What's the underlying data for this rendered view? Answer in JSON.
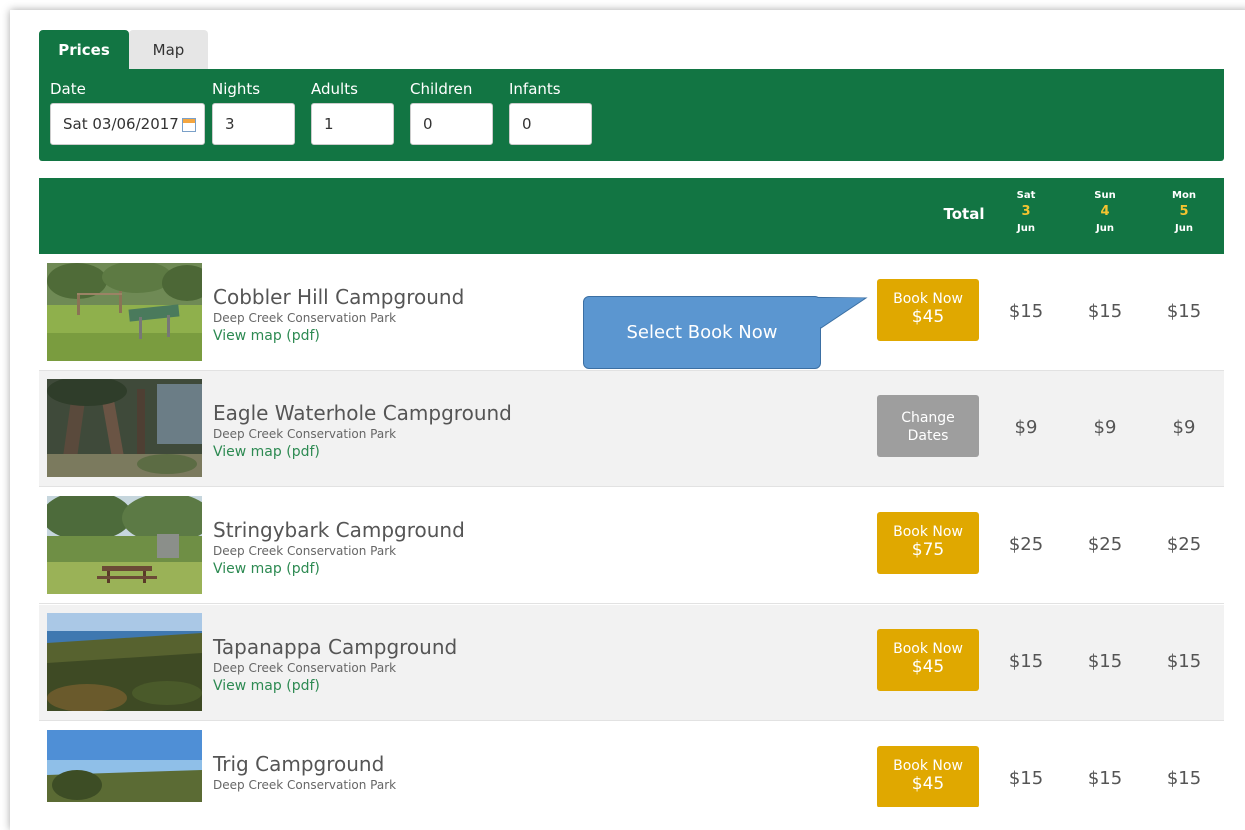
{
  "tabs": [
    {
      "label": "Prices",
      "active": true
    },
    {
      "label": "Map",
      "active": false
    }
  ],
  "filters": {
    "date": {
      "label": "Date",
      "value": "Sat 03/06/2017"
    },
    "nights": {
      "label": "Nights",
      "value": "3"
    },
    "adults": {
      "label": "Adults",
      "value": "1"
    },
    "children": {
      "label": "Children",
      "value": "0"
    },
    "infants": {
      "label": "Infants",
      "value": "0"
    }
  },
  "table_header": {
    "total_label": "Total",
    "days": [
      {
        "dow": "Sat",
        "day": "3",
        "month": "Jun"
      },
      {
        "dow": "Sun",
        "day": "4",
        "month": "Jun"
      },
      {
        "dow": "Mon",
        "day": "5",
        "month": "Jun"
      }
    ]
  },
  "campgrounds": [
    {
      "name": "Cobbler Hill Campground",
      "park": "Deep Creek Conservation Park",
      "link": "View map (pdf)",
      "button": {
        "type": "book",
        "line1": "Book Now",
        "line2": "$45"
      },
      "prices": [
        "$15",
        "$15",
        "$15"
      ]
    },
    {
      "name": "Eagle Waterhole Campground",
      "park": "Deep Creek Conservation Park",
      "link": "View map (pdf)",
      "button": {
        "type": "change",
        "line1": "Change",
        "line2": "Dates"
      },
      "prices": [
        "$9",
        "$9",
        "$9"
      ]
    },
    {
      "name": "Stringybark Campground",
      "park": "Deep Creek Conservation Park",
      "link": "View map (pdf)",
      "button": {
        "type": "book",
        "line1": "Book Now",
        "line2": "$75"
      },
      "prices": [
        "$25",
        "$25",
        "$25"
      ]
    },
    {
      "name": "Tapanappa Campground",
      "park": "Deep Creek Conservation Park",
      "link": "View map (pdf)",
      "button": {
        "type": "book",
        "line1": "Book Now",
        "line2": "$45"
      },
      "prices": [
        "$15",
        "$15",
        "$15"
      ]
    },
    {
      "name": "Trig Campground",
      "park": "Deep Creek Conservation Park",
      "link": "",
      "button": {
        "type": "book",
        "line1": "Book Now",
        "line2": "$45"
      },
      "prices": [
        "$15",
        "$15",
        "$15"
      ]
    }
  ],
  "callout": {
    "text": "Select Book Now"
  },
  "colors": {
    "brand_green": "#127543",
    "book_button": "#e0a800",
    "change_button": "#9e9e9e",
    "link_green": "#2d8a52",
    "callout_blue": "#5b96d0"
  },
  "icons": {
    "date_picker": "calendar-icon"
  }
}
